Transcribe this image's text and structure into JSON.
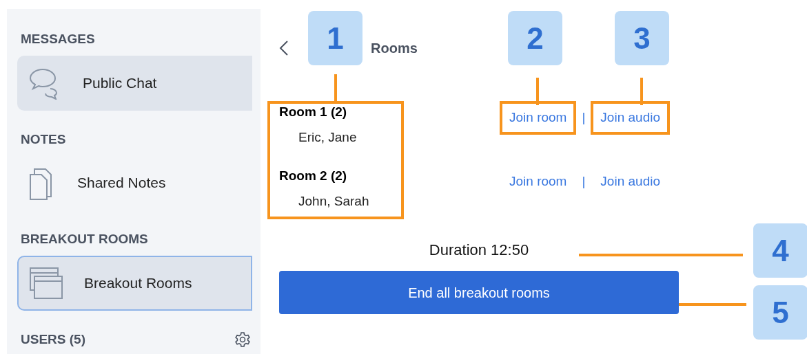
{
  "sidebar": {
    "sections": [
      {
        "title": "MESSAGES",
        "items": [
          {
            "label": "Public Chat",
            "highlighted": true,
            "selected": false
          }
        ]
      },
      {
        "title": "NOTES",
        "items": [
          {
            "label": "Shared Notes",
            "highlighted": false,
            "selected": false
          }
        ]
      },
      {
        "title": "BREAKOUT ROOMS",
        "items": [
          {
            "label": "Breakout Rooms",
            "highlighted": true,
            "selected": true
          }
        ]
      },
      {
        "title": "USERS (5)"
      }
    ]
  },
  "main": {
    "heading": "Rooms",
    "rooms": [
      {
        "title": "Room 1 (2)",
        "members": "Eric, Jane",
        "join_room": {
          "label": "Join room",
          "highlighted": true
        },
        "separator": "|",
        "join_audio": {
          "label": "Join audio",
          "highlighted": true
        }
      },
      {
        "title": "Room 2 (2)",
        "members": "John, Sarah",
        "join_room": {
          "label": "Join room",
          "highlighted": false
        },
        "separator": "|",
        "join_audio": {
          "label": "Join audio",
          "highlighted": false
        }
      }
    ],
    "rooms_highlighted": true,
    "duration": "Duration 12:50",
    "end_button": "End all breakout rooms"
  },
  "callouts": [
    {
      "label": "1"
    },
    {
      "label": "2"
    },
    {
      "label": "3"
    },
    {
      "label": "4"
    },
    {
      "label": "5"
    }
  ]
}
